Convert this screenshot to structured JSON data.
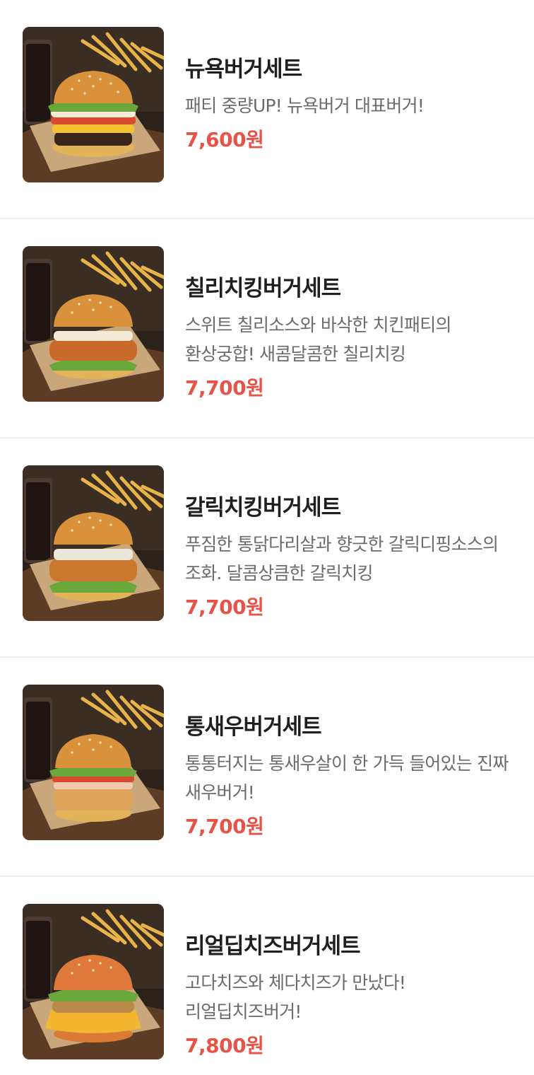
{
  "colors": {
    "price": "#e85348",
    "name": "#1f1f1f",
    "description": "#6b6b6b",
    "divider": "#ececec"
  },
  "menu": {
    "items": [
      {
        "name": "뉴욕버거세트",
        "description": "패티 중량UP! 뉴욕버거 대표버거!",
        "price": "7,600원",
        "image_icon": "burger-set-photo"
      },
      {
        "name": "칠리치킹버거세트",
        "description": "스위트 칠리소스와 바삭한 치킨패티의 환상궁합! 새콤달콤한 칠리치킹",
        "price": "7,700원",
        "image_icon": "burger-set-photo"
      },
      {
        "name": "갈릭치킹버거세트",
        "description": "푸짐한 통닭다리살과 향긋한 갈릭디핑소스의 조화. 달콤상큼한 갈릭치킹",
        "price": "7,700원",
        "image_icon": "burger-set-photo"
      },
      {
        "name": "통새우버거세트",
        "description": "통통터지는 통새우살이 한 가득 들어있는 진짜 새우버거!",
        "price": "7,700원",
        "image_icon": "burger-set-photo"
      },
      {
        "name": "리얼딥치즈버거세트",
        "description": "고다치즈와 체다치즈가 만났다! 리얼딥치즈버거!",
        "price": "7,800원",
        "image_icon": "burger-set-photo"
      }
    ]
  }
}
